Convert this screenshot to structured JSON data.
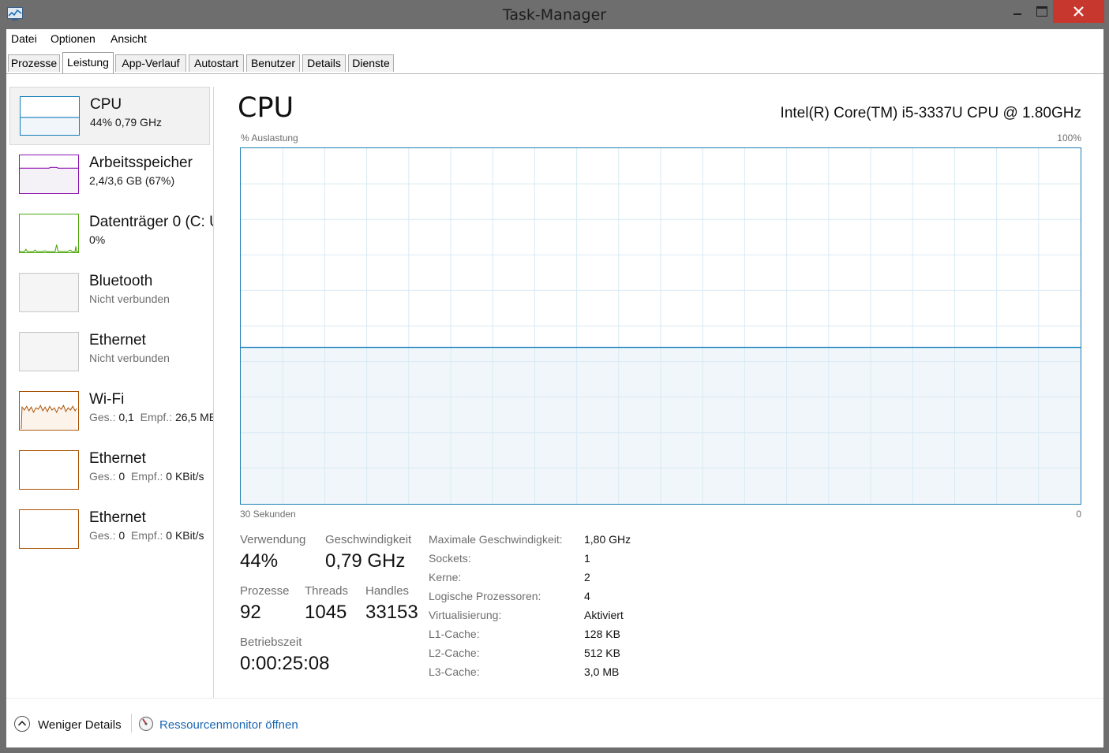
{
  "window": {
    "title": "Task-Manager",
    "icon": "task-manager-icon",
    "buttons": {
      "minimize": "minimize-icon",
      "maximize": "maximize-icon",
      "close": "close-icon"
    }
  },
  "menu": [
    "Datei",
    "Optionen",
    "Ansicht"
  ],
  "tabs": [
    "Prozesse",
    "Leistung",
    "App-Verlauf",
    "Autostart",
    "Benutzer",
    "Details",
    "Dienste"
  ],
  "active_tab": "Leistung",
  "sidebar": [
    {
      "title": "CPU",
      "sub": "44%  0,79 GHz",
      "selected": true,
      "color": "#117dbb"
    },
    {
      "title": "Arbeitsspeicher",
      "sub": "2,4/3,6 GB (67%)",
      "color": "#8b12ae"
    },
    {
      "title": "Datenträger 0 (C: U",
      "sub": "0%",
      "color": "#4da60c"
    },
    {
      "title": "Bluetooth",
      "sub": "Nicht verbunden",
      "color": "#a0a0a0"
    },
    {
      "title": "Ethernet",
      "sub": "Nicht verbunden",
      "color": "#a0a0a0"
    },
    {
      "title": "Wi-Fi",
      "sub_label1": "Ges.:",
      "sub_value1": "0,1",
      "sub_label2": "Empf.:",
      "sub_value2": "26,5 MB",
      "color": "#a74f01"
    },
    {
      "title": "Ethernet",
      "sub_label1": "Ges.:",
      "sub_value1": "0",
      "sub_label2": "Empf.:",
      "sub_value2": "0 KBit/s",
      "color": "#a74f01"
    },
    {
      "title": "Ethernet",
      "sub_label1": "Ges.:",
      "sub_value1": "0",
      "sub_label2": "Empf.:",
      "sub_value2": "0 KBit/s",
      "color": "#a74f01"
    }
  ],
  "main": {
    "title": "CPU",
    "model": "Intel(R) Core(TM) i5-3337U CPU @ 1.80GHz",
    "graph": {
      "y_label": "% Auslastung",
      "y_max_label": "100%",
      "x_label": "30 Sekunden",
      "x_min_label": "0",
      "utilization": 44,
      "accent": "#117dbb",
      "fill": "#f1f6fa",
      "grid": "#d9eaf4"
    },
    "stats": {
      "usage_label": "Verwendung",
      "usage_value": "44%",
      "speed_label": "Geschwindigkeit",
      "speed_value": "0,79 GHz",
      "processes_label": "Prozesse",
      "processes_value": "92",
      "threads_label": "Threads",
      "threads_value": "1045",
      "handles_label": "Handles",
      "handles_value": "33153",
      "uptime_label": "Betriebszeit",
      "uptime_value": "0:00:25:08"
    },
    "specs": [
      {
        "label": "Maximale Geschwindigkeit:",
        "value": "1,80 GHz"
      },
      {
        "label": "Sockets:",
        "value": "1"
      },
      {
        "label": "Kerne:",
        "value": "2"
      },
      {
        "label": "Logische Prozessoren:",
        "value": "4"
      },
      {
        "label": "Virtualisierung:",
        "value": "Aktiviert"
      },
      {
        "label": "L1-Cache:",
        "value": "128 KB"
      },
      {
        "label": "L2-Cache:",
        "value": "512 KB"
      },
      {
        "label": "L3-Cache:",
        "value": "3,0 MB"
      }
    ]
  },
  "footer": {
    "less_details_icon": "chevron-up-circle-icon",
    "less_details": "Weniger Details",
    "resmon_icon": "resource-monitor-icon",
    "resmon_link": "Ressourcenmonitor öffnen"
  }
}
